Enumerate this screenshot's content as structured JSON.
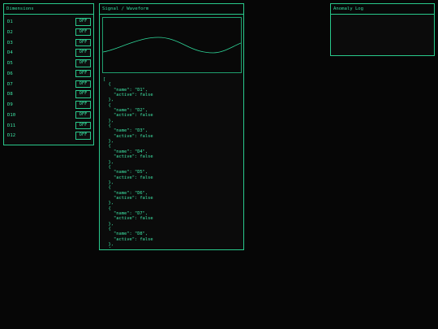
{
  "panels": {
    "dimensions": {
      "title": "Dimensions"
    },
    "waveform": {
      "title": "Signal / Waveform"
    },
    "anomaly": {
      "title": "Anomaly Log"
    }
  },
  "dimensions": [
    {
      "name": "D1",
      "toggle": "OFF"
    },
    {
      "name": "D2",
      "toggle": "OFF"
    },
    {
      "name": "D3",
      "toggle": "OFF"
    },
    {
      "name": "D4",
      "toggle": "OFF"
    },
    {
      "name": "D5",
      "toggle": "OFF"
    },
    {
      "name": "D6",
      "toggle": "OFF"
    },
    {
      "name": "D7",
      "toggle": "OFF"
    },
    {
      "name": "D8",
      "toggle": "OFF"
    },
    {
      "name": "D9",
      "toggle": "OFF"
    },
    {
      "name": "D10",
      "toggle": "OFF"
    },
    {
      "name": "D11",
      "toggle": "OFF"
    },
    {
      "name": "D12",
      "toggle": "OFF"
    }
  ],
  "waveform": {
    "json_text": "[\n  {\n    \"name\": \"D1\",\n    \"active\": false\n  },\n  {\n    \"name\": \"D2\",\n    \"active\": false\n  },\n  {\n    \"name\": \"D3\",\n    \"active\": false\n  },\n  {\n    \"name\": \"D4\",\n    \"active\": false\n  },\n  {\n    \"name\": \"D5\",\n    \"active\": false\n  },\n  {\n    \"name\": \"D6\",\n    \"active\": false\n  },\n  {\n    \"name\": \"D7\",\n    \"active\": false\n  },\n  {\n    \"name\": \"D8\",\n    \"active\": false\n  },\n  {"
  },
  "colors": {
    "background": "#060606",
    "panel": "#0b0b0b",
    "accent": "#29c98c",
    "text": "#3ee6a6"
  }
}
